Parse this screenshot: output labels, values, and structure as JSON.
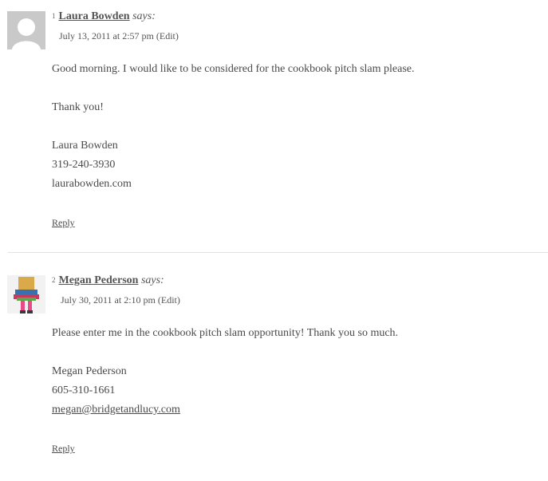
{
  "comments": [
    {
      "number": "1",
      "author": "Laura Bowden",
      "says": "says:",
      "date": "July 13, 2011 at 2:57 pm",
      "edit": "(Edit)",
      "avatar_icon": "default-person-icon",
      "lines": [
        "Good morning. I would like to be considered for the cookbook pitch slam please.",
        "Thank you!",
        "Laura Bowden",
        "319-240-3930",
        "laurabowden.com"
      ],
      "reply": "Reply"
    },
    {
      "number": "2",
      "author": "Megan Pederson",
      "says": "says:",
      "date": "July 30, 2011 at 2:10 pm",
      "edit": "(Edit)",
      "avatar_icon": "photo-avatar",
      "lines": [
        "Please enter me in the cookbook pitch slam opportunity! Thank you so much.",
        "Megan Pederson",
        "605-310-1661",
        "megan@bridgetandlucy.com"
      ],
      "reply": "Reply"
    }
  ],
  "colors": {
    "text": "#4a4a4a",
    "divider": "#e2e2e2",
    "default_avatar_bg": "#c9c9c9"
  }
}
